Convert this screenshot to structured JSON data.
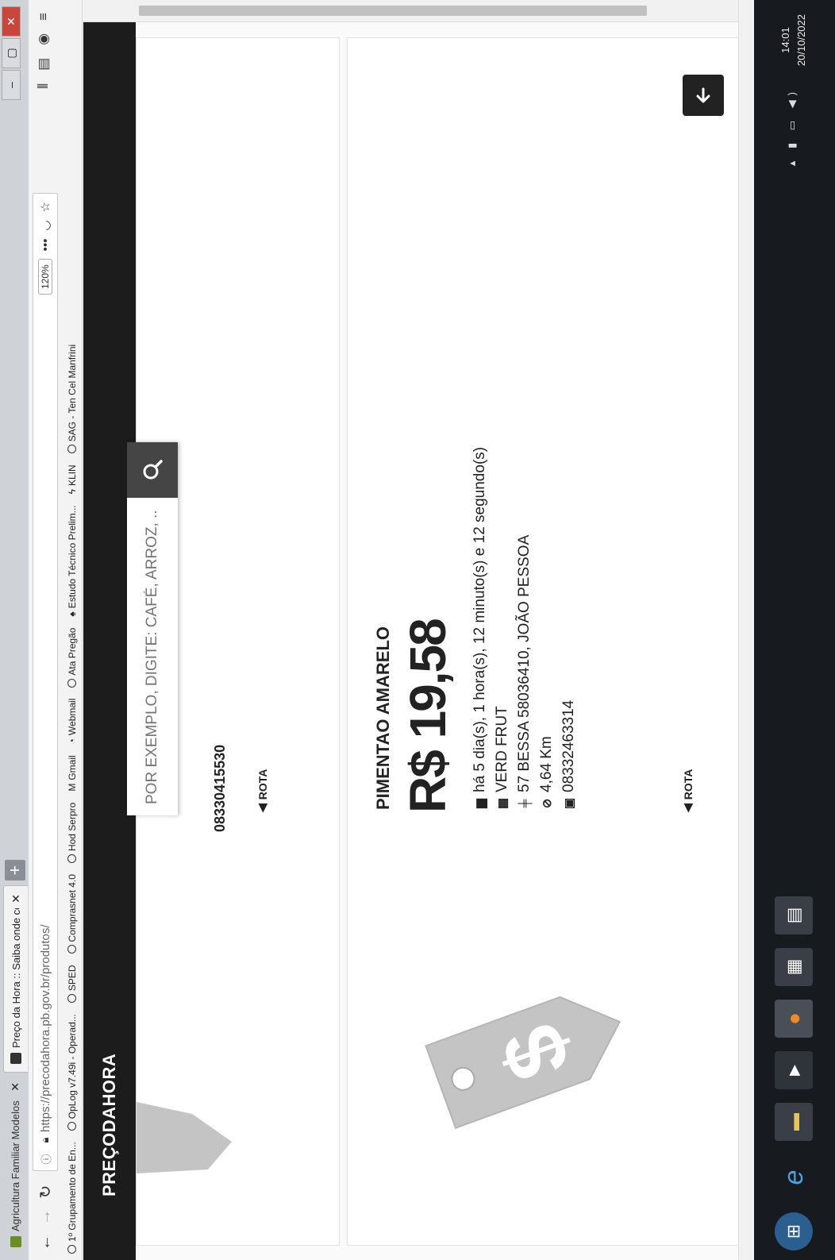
{
  "browser": {
    "tabs": [
      {
        "title": "Agricultura Familiar Modelos",
        "active": false
      },
      {
        "title": "Preço da Hora :: Saiba onde co",
        "active": true
      }
    ],
    "url": "https://precodahora.pb.gov.br/produtos/",
    "zoom": "120%",
    "bookmarks": [
      "1º Grupamento de En...",
      "OpLog v7.49i - Operad...",
      "SPED",
      "Comprasnet 4.0",
      "Hod Serpro",
      "Gmail",
      "Webmail",
      "Ata Pregão",
      "Estudo Técnico Prelim...",
      "KLIN",
      "SAG - Ten Cel Manfrini"
    ]
  },
  "site": {
    "logo": "PREÇODAHORA",
    "search_placeholder": "POR EXEMPLO, DIGITE: CAFÉ, ARROZ, ..."
  },
  "previous_card": {
    "phone_partial": "08330415530",
    "route_label": "ROTA"
  },
  "product": {
    "name": "PIMENTAO AMARELO",
    "price": "R$ 19,58",
    "time_ago": "há 5 dia(s), 1 hora(s), 12 minuto(s) e 12 segundo(s)",
    "store": "VERD FRUT",
    "address": "57 BESSA 58036410, JOÃO PESSOA",
    "distance": "4,64 Km",
    "phone": "08332463314",
    "route_label": "ROTA"
  },
  "taskbar": {
    "time": "14:01",
    "date": "20/10/2022"
  },
  "colors": {
    "sitebar": "#1c1c1c",
    "tag": "#c4c4c4",
    "taskbar": "#171a1e"
  },
  "icons": [
    "back-arrow-icon",
    "forward-arrow-icon",
    "reload-icon",
    "home-icon",
    "lock-icon",
    "star-icon",
    "search-icon",
    "price-tag-icon",
    "calendar-icon",
    "store-icon",
    "address-icon",
    "distance-icon",
    "phone-icon",
    "route-arrow-icon",
    "arrow-left-icon"
  ]
}
